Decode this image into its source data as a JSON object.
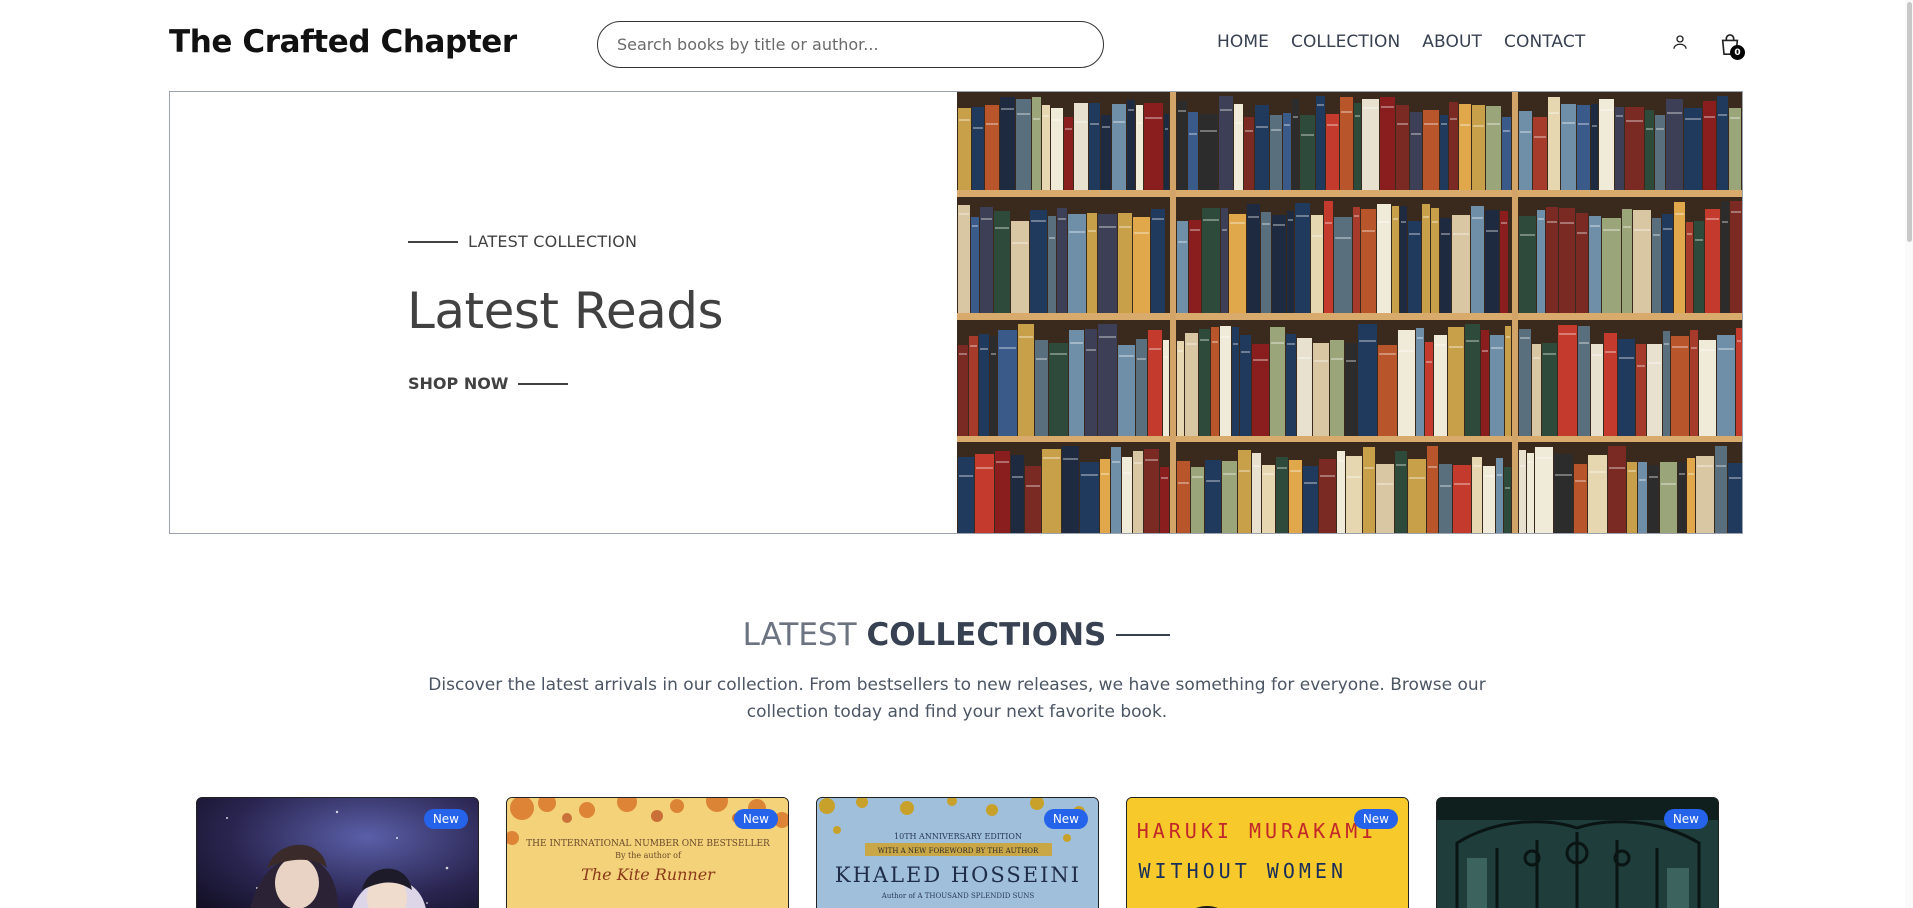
{
  "header": {
    "logo": "The Crafted Chapter",
    "search_placeholder": "Search books by title or author...",
    "nav": [
      "HOME",
      "COLLECTION",
      "ABOUT",
      "CONTACT"
    ],
    "cart_count": "0",
    "icons": {
      "user": "user-icon",
      "cart": "shopping-bag-icon"
    }
  },
  "hero": {
    "eyebrow": "LATEST COLLECTION",
    "title": "Latest Reads",
    "cta": "SHOP NOW",
    "image": "bookshelf-photo"
  },
  "section": {
    "title_light": "LATEST",
    "title_bold": "COLLECTIONS",
    "description": "Discover the latest arrivals in our collection. From bestsellers to new releases, we have something for everyone. Browse our collection today and find your next favorite book."
  },
  "products": [
    {
      "badge": "New",
      "cover": "anime-space-cover"
    },
    {
      "badge": "New",
      "cover": "kite-runner-author-cover",
      "cover_text_top": "THE INTERNATIONAL NUMBER ONE BESTSELLER",
      "cover_text_sub": "By the author of",
      "cover_text_title": "The Kite Runner"
    },
    {
      "badge": "New",
      "cover": "khaled-hosseini-cover",
      "cover_text_top": "10TH ANNIVERSARY EDITION",
      "cover_text_band": "WITH A NEW FOREWORD BY THE AUTHOR",
      "cover_text_title": "KHALED HOSSEINI",
      "cover_text_sub": "Author of A THOUSAND SPLENDID SUNS"
    },
    {
      "badge": "New",
      "cover": "murakami-cover",
      "cover_text_author": "HARUKI MURAKAMI",
      "cover_text_title": "MEN WITHOUT WOMEN"
    },
    {
      "badge": "New",
      "cover": "green-gate-cover"
    }
  ],
  "colors": {
    "accent": "#2563eb",
    "text": "#414141",
    "nav": "#374151"
  }
}
